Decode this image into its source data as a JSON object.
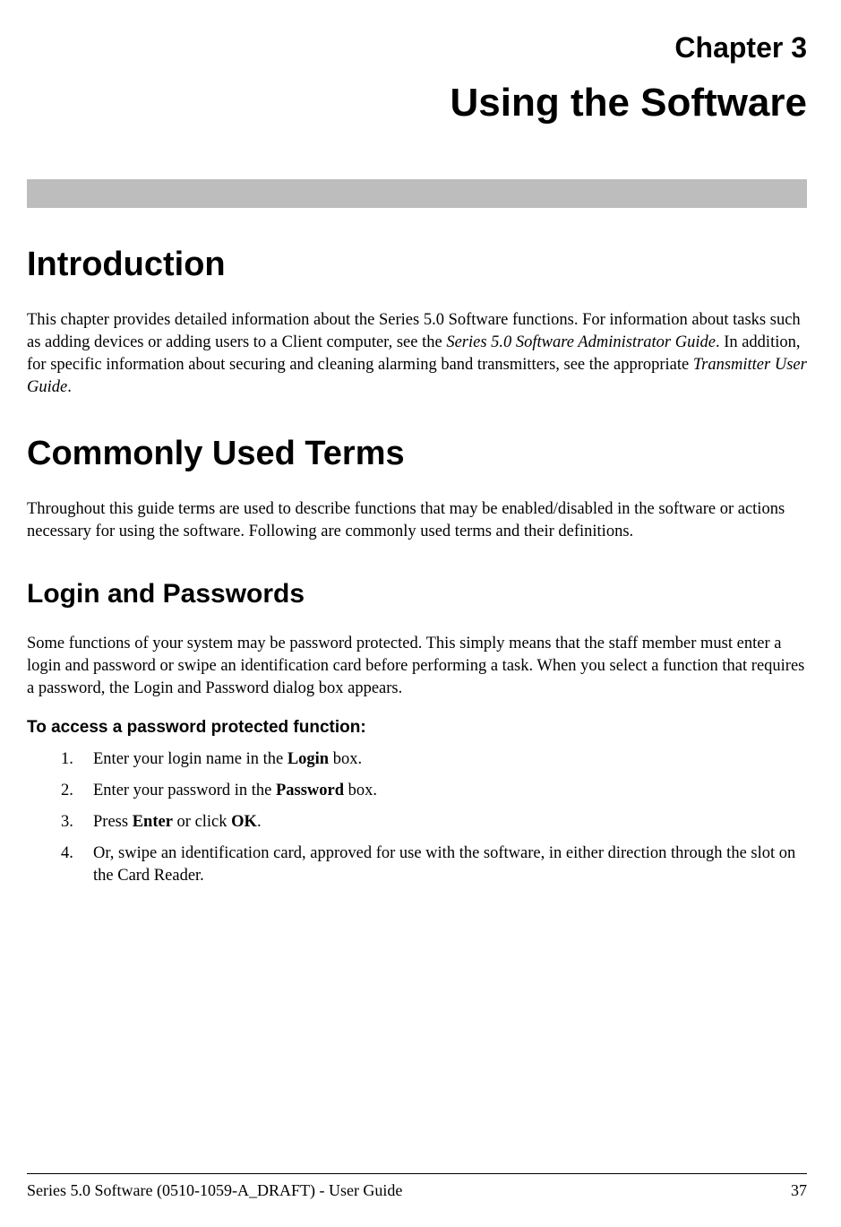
{
  "chapter": {
    "label": "Chapter 3",
    "title": "Using the Software"
  },
  "sections": {
    "introduction": {
      "heading": "Introduction",
      "paragraph_prefix": "This chapter provides detailed information about the Series 5.0 Software functions. For information about tasks such as adding devices or adding users to a Client computer, see the ",
      "ref1": "Series 5.0 Software Administrator Guide",
      "paragraph_mid": ". In addition, for specific information about securing and cleaning alarming band transmitters, see the appropriate ",
      "ref2": "Transmitter User Guide",
      "paragraph_suffix": "."
    },
    "commonly_used_terms": {
      "heading": "Commonly Used Terms",
      "paragraph": "Throughout this guide terms are used to describe functions that may be enabled/disabled in the software or actions necessary for using the software. Following are commonly used terms and their definitions."
    },
    "login_passwords": {
      "heading": "Login and Passwords",
      "paragraph": "Some functions of your system may be password protected. This simply means that the staff member must enter a login and password or swipe an identification card before performing a task. When you select a function that requires a password, the Login and Password dialog box appears.",
      "procedure_heading": "To access a password protected function:",
      "steps": [
        {
          "num": "1.",
          "pre": "Enter your login name in the ",
          "bold": "Login",
          "post": " box."
        },
        {
          "num": "2.",
          "pre": "Enter your password in the ",
          "bold": "Password",
          "post": " box."
        },
        {
          "num": "3.",
          "pre": "Press ",
          "bold": "Enter",
          "mid": " or click ",
          "bold2": "OK",
          "post": "."
        },
        {
          "num": "4.",
          "pre": "Or, swipe an identification card, approved for use with the software, in either direction through the slot on the Card Reader.",
          "bold": "",
          "post": ""
        }
      ]
    }
  },
  "footer": {
    "left": "Series 5.0 Software (0510-1059-A_DRAFT) - User Guide",
    "right": "37"
  }
}
